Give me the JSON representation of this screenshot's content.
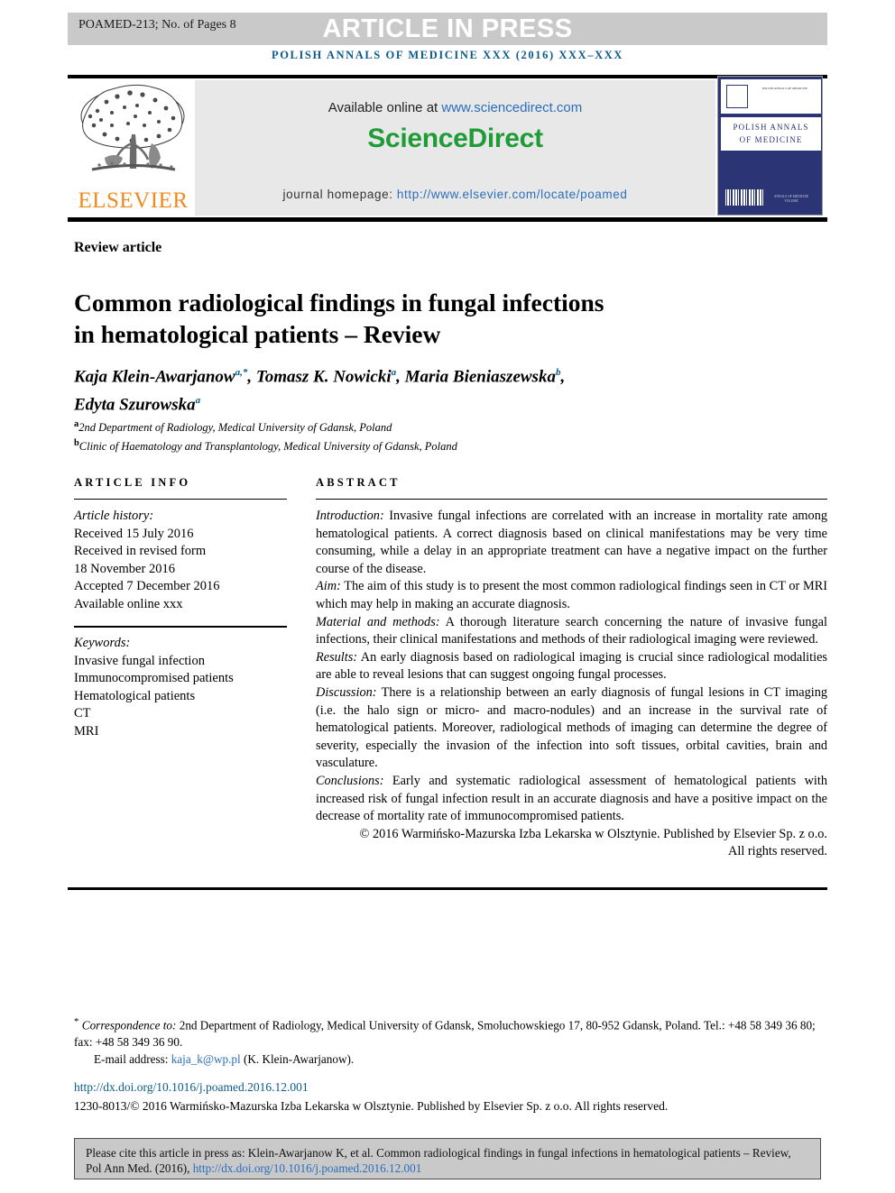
{
  "header": {
    "manuscript_id": "POAMED-213; No. of Pages 8",
    "article_in_press": "ARTICLE IN PRESS",
    "journal_running_head": "POLISH ANNALS OF MEDICINE XXX (2016) XXX–XXX"
  },
  "masthead": {
    "publisher_name": "ELSEVIER",
    "available_prefix": "Available online at ",
    "available_url": "www.sciencedirect.com",
    "sciencedirect_brand": "ScienceDirect",
    "homepage_prefix": "journal homepage: ",
    "homepage_url": "http://www.elsevier.com/locate/poamed",
    "cover_title_line1": "POLISH ANNALS",
    "cover_title_line2": "OF MEDICINE",
    "cover_mini_text": "POLISH ANNALS OF MEDICINE",
    "cover_bottom_text": "ANNALS OF MEDICINE VOLUME"
  },
  "article": {
    "type_label": "Review article",
    "title_line1": "Common radiological findings in fungal infections",
    "title_line2": "in hematological patients – Review",
    "authors_line1_a": "Kaja Klein-Awarjanow",
    "authors_line1_a_sup": "a,*",
    "authors_line1_b": ", Tomasz K. Nowicki",
    "authors_line1_b_sup": "a",
    "authors_line1_c": ", Maria Bieniaszewska",
    "authors_line1_c_sup": "b",
    "authors_line1_d": ",",
    "authors_line2": "Edyta Szurowska",
    "authors_line2_sup": "a",
    "affiliation_a_marker": "a",
    "affiliation_a": "2nd Department of Radiology, Medical University of Gdansk, Poland",
    "affiliation_b_marker": "b",
    "affiliation_b": "Clinic of Haematology and Transplantology, Medical University of Gdansk, Poland"
  },
  "article_info": {
    "heading": "ARTICLE INFO",
    "history_label": "Article history:",
    "history": [
      "Received 15 July 2016",
      "Received in revised form",
      "18 November 2016",
      "Accepted 7 December 2016",
      "Available online xxx"
    ],
    "keywords_label": "Keywords:",
    "keywords": [
      "Invasive fungal infection",
      "Immunocompromised patients",
      "Hematological patients",
      "CT",
      "MRI"
    ]
  },
  "abstract": {
    "heading": "ABSTRACT",
    "sections": [
      {
        "label": "Introduction:",
        "text": " Invasive fungal infections are correlated with an increase in mortality rate among hematological patients. A correct diagnosis based on clinical manifestations may be very time consuming, while a delay in an appropriate treatment can have a negative impact on the further course of the disease."
      },
      {
        "label": "Aim:",
        "text": " The aim of this study is to present the most common radiological findings seen in CT or MRI which may help in making an accurate diagnosis."
      },
      {
        "label": "Material and methods:",
        "text": " A thorough literature search concerning the nature of invasive fungal infections, their clinical manifestations and methods of their radiological imaging were reviewed."
      },
      {
        "label": "Results:",
        "text": " An early diagnosis based on radiological imaging is crucial since radiological modalities are able to reveal lesions that can suggest ongoing fungal processes."
      },
      {
        "label": "Discussion:",
        "text": " There is a relationship between an early diagnosis of fungal lesions in CT imaging (i.e. the halo sign or micro- and macro-nodules) and an increase in the survival rate of hematological patients. Moreover, radiological methods of imaging can determine the degree of severity, especially the invasion of the infection into soft tissues, orbital cavities, brain and vasculature."
      },
      {
        "label": "Conclusions:",
        "text": " Early and systematic radiological assessment of hematological patients with increased risk of fungal infection result in an accurate diagnosis and have a positive impact on the decrease of mortality rate of immunocompromised patients."
      }
    ],
    "copyright_line1": "© 2016 Warmińsko-Mazurska Izba Lekarska w Olsztynie. Published by Elsevier Sp. z o.o.",
    "copyright_line2": "All rights reserved."
  },
  "footer": {
    "corr_marker": "*",
    "corr_label": "Correspondence to:",
    "corr_address": " 2nd Department of Radiology, Medical University of Gdansk, Smoluchowskiego 17, 80-952 Gdansk, Poland. Tel.: +48 58 349 36 80; fax: +48 58 349 36 90.",
    "email_label": "E-mail address:",
    "email_link": "kaja_k@wp.pl",
    "email_suffix": " (K. Klein-Awarjanow).",
    "doi_url": "http://dx.doi.org/10.1016/j.poamed.2016.12.001",
    "issn_line": "1230-8013/© 2016 Warmińsko-Mazurska Izba Lekarska w Olsztynie. Published by Elsevier Sp. z o.o. All rights reserved."
  },
  "cite_box": {
    "text": "Please cite this article in press as: Klein-Awarjanow K, et al. Common radiological findings in fungal infections in hematological patients – Review, Pol Ann Med. (2016), ",
    "link": "http://dx.doi.org/10.1016/j.poamed.2016.12.001"
  },
  "colors": {
    "journal_blue": "#0b5a8a",
    "link_blue": "#2a6ebb",
    "sciencedirect_green": "#1f9c37",
    "elsevier_orange": "#f08a1e",
    "band_grey": "#c9c9c9",
    "panel_grey": "#e8e8e8",
    "cover_navy": "#2b3576"
  }
}
